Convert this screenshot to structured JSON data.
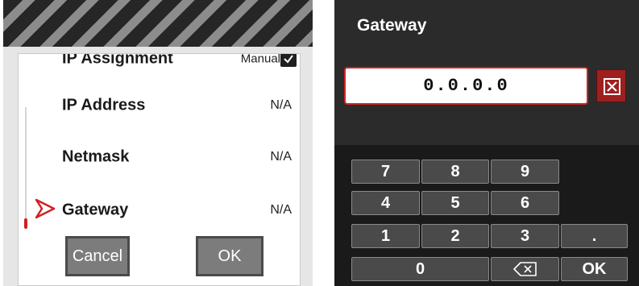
{
  "settings": {
    "rows": [
      {
        "label": "IP Assignment",
        "value": "Manual"
      },
      {
        "label": "IP Address",
        "value": "N/A"
      },
      {
        "label": "Netmask",
        "value": "N/A"
      },
      {
        "label": "Gateway",
        "value": "N/A"
      }
    ],
    "selected_row": "Gateway",
    "buttons": {
      "cancel": "Cancel",
      "ok": "OK"
    }
  },
  "keypad_dialog": {
    "title": "Gateway",
    "field_value": "0.0.0.0",
    "keys": {
      "k7": "7",
      "k8": "8",
      "k9": "9",
      "k4": "4",
      "k5": "5",
      "k6": "6",
      "k1": "1",
      "k2": "2",
      "k3": "3",
      "dot": ".",
      "k0": "0",
      "ok": "OK"
    }
  },
  "colors": {
    "accent_red": "#d02323",
    "dark_panel": "#2b2b2b",
    "key_face": "#4a4a4a"
  },
  "icons": {
    "clear": "clear-x-icon",
    "backspace": "backspace-icon",
    "pointer": "selection-arrow-icon",
    "checkbox": "checkbox-icon"
  }
}
